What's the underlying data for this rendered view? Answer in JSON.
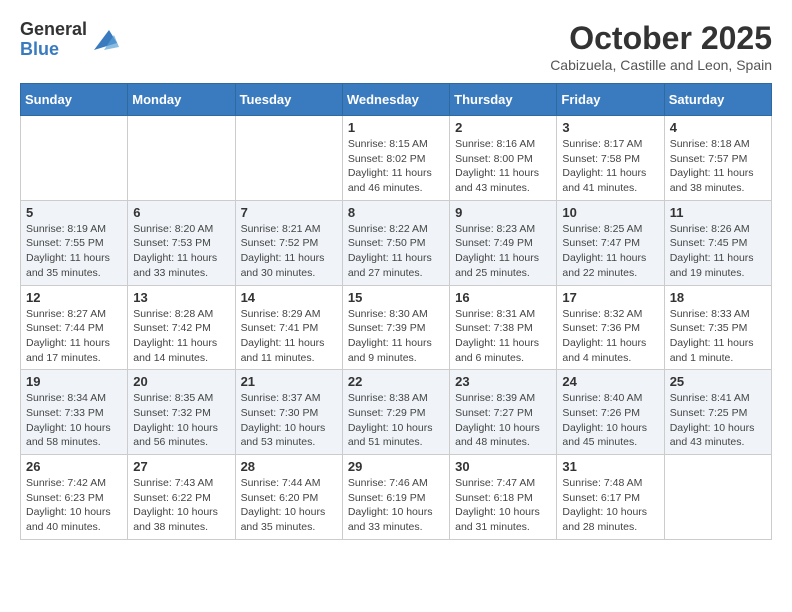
{
  "header": {
    "logo_line1": "General",
    "logo_line2": "Blue",
    "month": "October 2025",
    "location": "Cabizuela, Castille and Leon, Spain"
  },
  "weekdays": [
    "Sunday",
    "Monday",
    "Tuesday",
    "Wednesday",
    "Thursday",
    "Friday",
    "Saturday"
  ],
  "weeks": [
    [
      {
        "day": "",
        "info": ""
      },
      {
        "day": "",
        "info": ""
      },
      {
        "day": "",
        "info": ""
      },
      {
        "day": "1",
        "info": "Sunrise: 8:15 AM\nSunset: 8:02 PM\nDaylight: 11 hours\nand 46 minutes."
      },
      {
        "day": "2",
        "info": "Sunrise: 8:16 AM\nSunset: 8:00 PM\nDaylight: 11 hours\nand 43 minutes."
      },
      {
        "day": "3",
        "info": "Sunrise: 8:17 AM\nSunset: 7:58 PM\nDaylight: 11 hours\nand 41 minutes."
      },
      {
        "day": "4",
        "info": "Sunrise: 8:18 AM\nSunset: 7:57 PM\nDaylight: 11 hours\nand 38 minutes."
      }
    ],
    [
      {
        "day": "5",
        "info": "Sunrise: 8:19 AM\nSunset: 7:55 PM\nDaylight: 11 hours\nand 35 minutes."
      },
      {
        "day": "6",
        "info": "Sunrise: 8:20 AM\nSunset: 7:53 PM\nDaylight: 11 hours\nand 33 minutes."
      },
      {
        "day": "7",
        "info": "Sunrise: 8:21 AM\nSunset: 7:52 PM\nDaylight: 11 hours\nand 30 minutes."
      },
      {
        "day": "8",
        "info": "Sunrise: 8:22 AM\nSunset: 7:50 PM\nDaylight: 11 hours\nand 27 minutes."
      },
      {
        "day": "9",
        "info": "Sunrise: 8:23 AM\nSunset: 7:49 PM\nDaylight: 11 hours\nand 25 minutes."
      },
      {
        "day": "10",
        "info": "Sunrise: 8:25 AM\nSunset: 7:47 PM\nDaylight: 11 hours\nand 22 minutes."
      },
      {
        "day": "11",
        "info": "Sunrise: 8:26 AM\nSunset: 7:45 PM\nDaylight: 11 hours\nand 19 minutes."
      }
    ],
    [
      {
        "day": "12",
        "info": "Sunrise: 8:27 AM\nSunset: 7:44 PM\nDaylight: 11 hours\nand 17 minutes."
      },
      {
        "day": "13",
        "info": "Sunrise: 8:28 AM\nSunset: 7:42 PM\nDaylight: 11 hours\nand 14 minutes."
      },
      {
        "day": "14",
        "info": "Sunrise: 8:29 AM\nSunset: 7:41 PM\nDaylight: 11 hours\nand 11 minutes."
      },
      {
        "day": "15",
        "info": "Sunrise: 8:30 AM\nSunset: 7:39 PM\nDaylight: 11 hours\nand 9 minutes."
      },
      {
        "day": "16",
        "info": "Sunrise: 8:31 AM\nSunset: 7:38 PM\nDaylight: 11 hours\nand 6 minutes."
      },
      {
        "day": "17",
        "info": "Sunrise: 8:32 AM\nSunset: 7:36 PM\nDaylight: 11 hours\nand 4 minutes."
      },
      {
        "day": "18",
        "info": "Sunrise: 8:33 AM\nSunset: 7:35 PM\nDaylight: 11 hours\nand 1 minute."
      }
    ],
    [
      {
        "day": "19",
        "info": "Sunrise: 8:34 AM\nSunset: 7:33 PM\nDaylight: 10 hours\nand 58 minutes."
      },
      {
        "day": "20",
        "info": "Sunrise: 8:35 AM\nSunset: 7:32 PM\nDaylight: 10 hours\nand 56 minutes."
      },
      {
        "day": "21",
        "info": "Sunrise: 8:37 AM\nSunset: 7:30 PM\nDaylight: 10 hours\nand 53 minutes."
      },
      {
        "day": "22",
        "info": "Sunrise: 8:38 AM\nSunset: 7:29 PM\nDaylight: 10 hours\nand 51 minutes."
      },
      {
        "day": "23",
        "info": "Sunrise: 8:39 AM\nSunset: 7:27 PM\nDaylight: 10 hours\nand 48 minutes."
      },
      {
        "day": "24",
        "info": "Sunrise: 8:40 AM\nSunset: 7:26 PM\nDaylight: 10 hours\nand 45 minutes."
      },
      {
        "day": "25",
        "info": "Sunrise: 8:41 AM\nSunset: 7:25 PM\nDaylight: 10 hours\nand 43 minutes."
      }
    ],
    [
      {
        "day": "26",
        "info": "Sunrise: 7:42 AM\nSunset: 6:23 PM\nDaylight: 10 hours\nand 40 minutes."
      },
      {
        "day": "27",
        "info": "Sunrise: 7:43 AM\nSunset: 6:22 PM\nDaylight: 10 hours\nand 38 minutes."
      },
      {
        "day": "28",
        "info": "Sunrise: 7:44 AM\nSunset: 6:20 PM\nDaylight: 10 hours\nand 35 minutes."
      },
      {
        "day": "29",
        "info": "Sunrise: 7:46 AM\nSunset: 6:19 PM\nDaylight: 10 hours\nand 33 minutes."
      },
      {
        "day": "30",
        "info": "Sunrise: 7:47 AM\nSunset: 6:18 PM\nDaylight: 10 hours\nand 31 minutes."
      },
      {
        "day": "31",
        "info": "Sunrise: 7:48 AM\nSunset: 6:17 PM\nDaylight: 10 hours\nand 28 minutes."
      },
      {
        "day": "",
        "info": ""
      }
    ]
  ]
}
